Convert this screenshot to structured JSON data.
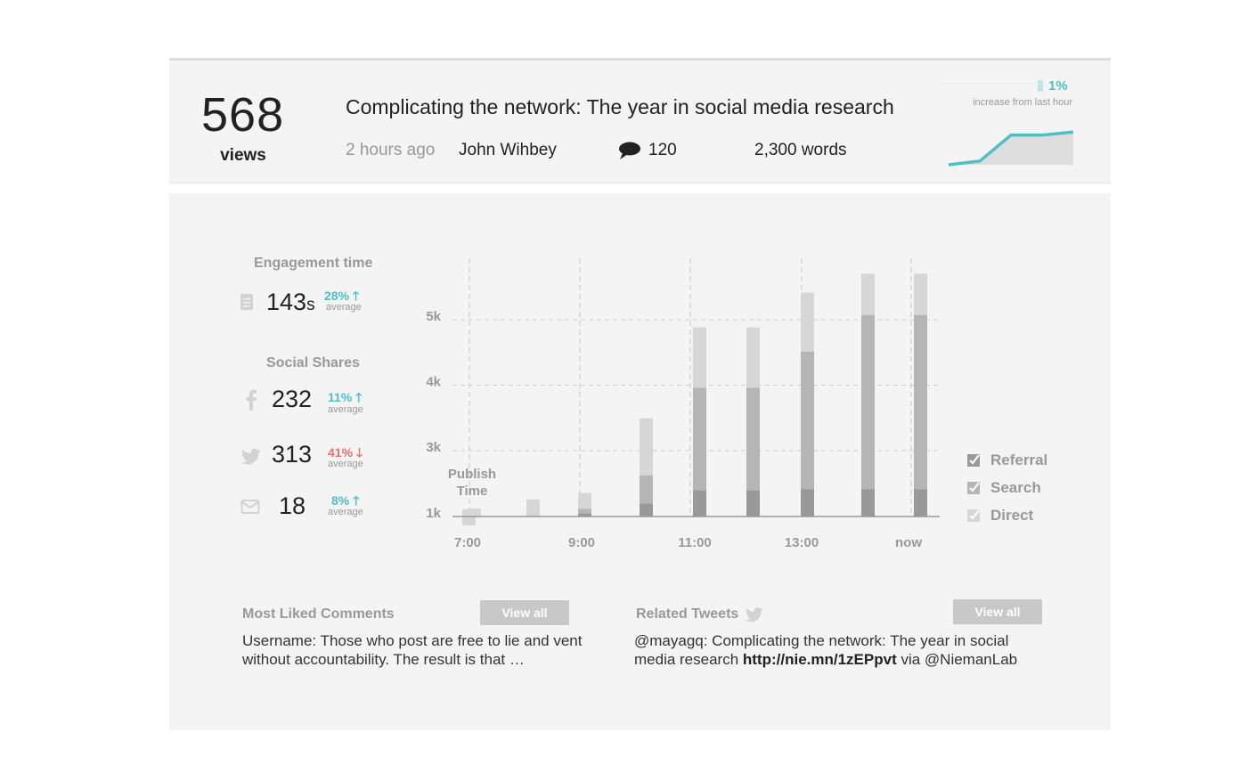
{
  "header": {
    "views": "568",
    "views_label": "views",
    "title": "Complicating the network: The year in social media research",
    "published": "2 hours ago",
    "author": "John Wihbey",
    "comments_count": "120",
    "word_count": "2,300 words",
    "trend_percent": "1%",
    "trend_caption": "increase from last hour",
    "trend_values": [
      0,
      0.12,
      0.98,
      0.98,
      1.08
    ],
    "accent_color": "#4fbfc6"
  },
  "engagement": {
    "title": "Engagement time",
    "icon": "document-icon",
    "value": "143",
    "unit": "s",
    "delta": "28%",
    "delta_sub": "average"
  },
  "social": {
    "title": "Social Shares",
    "items": [
      {
        "icon": "facebook-icon",
        "value": "232",
        "delta": "11%",
        "direction": "up",
        "sub": "average"
      },
      {
        "icon": "twitter-icon",
        "value": "313",
        "delta": "41%",
        "direction": "down",
        "sub": "average"
      },
      {
        "icon": "mail-icon",
        "value": "18",
        "delta": "8%",
        "direction": "up",
        "sub": "average"
      }
    ]
  },
  "chart_data": {
    "type": "bar",
    "stacked": true,
    "y_ticks": [
      "1k",
      "3k",
      "4k",
      "5k"
    ],
    "x_tick_labels": [
      "7:00",
      "9:00",
      "11:00",
      "13:00",
      "now"
    ],
    "annotation": "Publish Time",
    "series": [
      {
        "name": "Direct",
        "color": "#999999",
        "values": [
          0,
          0,
          0.05,
          0.2,
          0.4,
          0.4,
          0.42,
          0.42,
          0.42
        ]
      },
      {
        "name": "Search",
        "color": "#b5b5b5",
        "values": [
          0,
          0,
          0.07,
          0.43,
          1.57,
          1.57,
          2.1,
          2.66,
          2.66
        ]
      },
      {
        "name": "Referral",
        "color": "#d6d6d6",
        "values": [
          0.12,
          0.26,
          0.24,
          0.87,
          0.92,
          0.92,
          0.9,
          0.63,
          0.63
        ]
      }
    ],
    "categories": [
      "b1",
      "b2",
      "b3",
      "b4",
      "b5",
      "b6",
      "b7",
      "b8",
      "b9"
    ],
    "legend": [
      "Referral",
      "Search",
      "Direct"
    ],
    "legend_placement": "right",
    "grid": true
  },
  "comments": {
    "title": "Most Liked Comments",
    "view_all": "View all",
    "text": "Username: Those who post are free to lie and vent without accountability. The result is that …"
  },
  "tweets": {
    "title": "Related Tweets",
    "view_all": "View all",
    "text_before": "@mayagq: Complicating the network: The year in social media research ",
    "link": "http://nie.mn/1zEPpvt",
    "text_after": " via @NiemanLab"
  }
}
